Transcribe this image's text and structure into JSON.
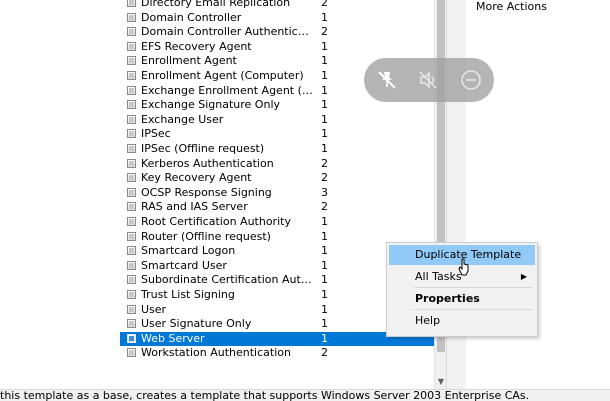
{
  "templates": [
    {
      "name": "Directory Email Replication",
      "version": "2"
    },
    {
      "name": "Domain Controller",
      "version": "1"
    },
    {
      "name": "Domain Controller Authentication",
      "version": "2"
    },
    {
      "name": "EFS Recovery Agent",
      "version": "1"
    },
    {
      "name": "Enrollment Agent",
      "version": "1"
    },
    {
      "name": "Enrollment Agent (Computer)",
      "version": "1"
    },
    {
      "name": "Exchange Enrollment Agent (Offline requ...",
      "version": "1"
    },
    {
      "name": "Exchange Signature Only",
      "version": "1"
    },
    {
      "name": "Exchange User",
      "version": "1"
    },
    {
      "name": "IPSec",
      "version": "1"
    },
    {
      "name": "IPSec (Offline request)",
      "version": "1"
    },
    {
      "name": "Kerberos Authentication",
      "version": "2"
    },
    {
      "name": "Key Recovery Agent",
      "version": "2"
    },
    {
      "name": "OCSP Response Signing",
      "version": "3"
    },
    {
      "name": "RAS and IAS Server",
      "version": "2"
    },
    {
      "name": "Root Certification Authority",
      "version": "1"
    },
    {
      "name": "Router (Offline request)",
      "version": "1"
    },
    {
      "name": "Smartcard Logon",
      "version": "1"
    },
    {
      "name": "Smartcard User",
      "version": "1"
    },
    {
      "name": "Subordinate Certification Authority",
      "version": "1"
    },
    {
      "name": "Trust List Signing",
      "version": "1"
    },
    {
      "name": "User",
      "version": "1"
    },
    {
      "name": "User Signature Only",
      "version": "1"
    },
    {
      "name": "Web Server",
      "version": "1"
    },
    {
      "name": "Workstation Authentication",
      "version": "2"
    }
  ],
  "selected_template": "Web Server",
  "actions": {
    "more_actions": "More Actions"
  },
  "context_menu": {
    "items": [
      {
        "label": "Duplicate Template",
        "submenu": false,
        "bold": false,
        "hover": true
      },
      {
        "label": "All Tasks",
        "submenu": true,
        "bold": false,
        "hover": false
      },
      {
        "label": "Properties",
        "submenu": false,
        "bold": true,
        "hover": false
      },
      {
        "label": "Help",
        "submenu": false,
        "bold": false,
        "hover": false
      }
    ]
  },
  "status_bar": {
    "text": "this template as a base, creates a template that supports Windows Server 2003 Enterprise CAs."
  },
  "icons": {
    "toolbar": [
      "pin-off-icon",
      "mute-icon",
      "minus-icon"
    ],
    "template_icon": "certificate-template-icon",
    "submenu_arrow": "chevron-right-icon"
  },
  "colors": {
    "selection": "#0078d7",
    "menu_hover": "#91c9f7"
  }
}
